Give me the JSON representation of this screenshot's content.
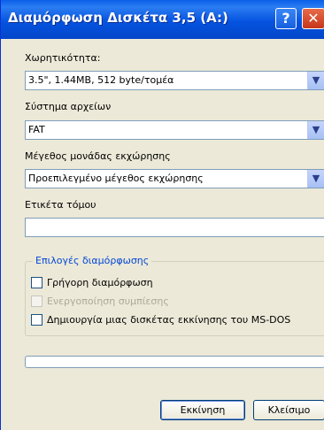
{
  "window": {
    "title": "Διαμόρφωση Δισκέτα 3,5 (A:)",
    "help_glyph": "?",
    "close_glyph": "✕"
  },
  "capacity": {
    "label": "Χωρητικότητα:",
    "value": "3.5\",  1.44MB, 512 byte/τομέα"
  },
  "filesystem": {
    "label": "Σύστημα αρχείων",
    "value": "FAT"
  },
  "allocation": {
    "label": "Μέγεθος μονάδας εκχώρησης",
    "value": "Προεπιλεγμένο μέγεθος εκχώρησης"
  },
  "volume_label": {
    "label": "Ετικέτα τόμου",
    "value": ""
  },
  "options": {
    "legend": "Επιλογές διαμόρφωσης",
    "quick_format": {
      "label": "Γρήγορη διαμόρφωση",
      "checked": false
    },
    "compression": {
      "label": "Ενεργοποίηση συμπίεσης",
      "checked": false,
      "enabled": false
    },
    "msdos_startup": {
      "label": "Δημιουργία μιας δισκέτας εκκίνησης του MS-DOS",
      "checked": false
    }
  },
  "progress": {
    "fraction": 0
  },
  "buttons": {
    "start": "Εκκίνηση",
    "close": "Κλείσιμο"
  },
  "icons": {
    "dropdown": "chevron-down-icon"
  }
}
